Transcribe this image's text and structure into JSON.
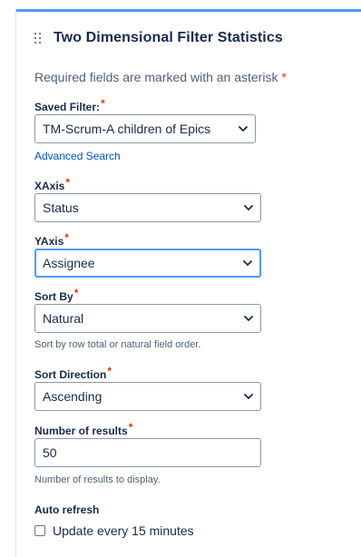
{
  "gadget": {
    "title": "Two Dimensional Filter Statistics",
    "required_note": "Required fields are marked with an asterisk",
    "required_marker": "*"
  },
  "fields": {
    "saved_filter": {
      "label": "Saved Filter:",
      "value": "TM-Scrum-A children of Epics"
    },
    "advanced_search": "Advanced Search",
    "xaxis": {
      "label": "XAxis",
      "value": "Status"
    },
    "yaxis": {
      "label": "YAxis",
      "value": "Assignee"
    },
    "sort_by": {
      "label": "Sort By",
      "value": "Natural",
      "help": "Sort by row total or natural field order."
    },
    "sort_direction": {
      "label": "Sort Direction",
      "value": "Ascending"
    },
    "num_results": {
      "label": "Number of results",
      "value": "50",
      "help": "Number of results to display."
    },
    "auto_refresh": {
      "label": "Auto refresh",
      "checkbox_label": "Update every 15 minutes",
      "checked": false
    }
  },
  "icons": {
    "drag": "drag-handle-icon",
    "chevron": "chevron-down-icon"
  },
  "colors": {
    "accent": "#4c9aff",
    "link": "#0052cc",
    "required": "#de350b"
  }
}
